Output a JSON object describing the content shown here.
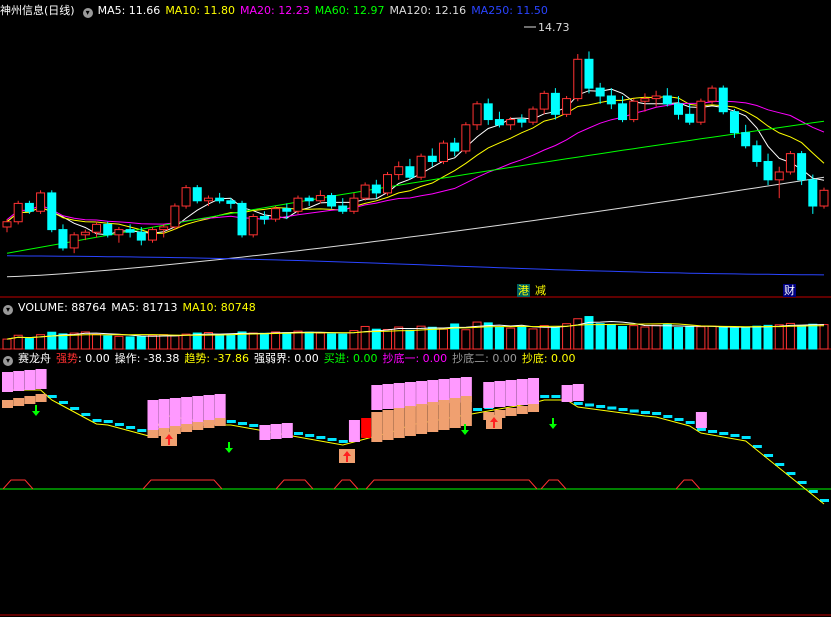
{
  "main_header": {
    "stock_name": "神州信息(日线)",
    "ma_items": [
      {
        "label": "MA5: 11.66",
        "color": "#ffffff"
      },
      {
        "label": "MA10: 11.80",
        "color": "#ffff00"
      },
      {
        "label": "MA20: 12.23",
        "color": "#ff00ff"
      },
      {
        "label": "MA60: 12.97",
        "color": "#00ff00"
      },
      {
        "label": "MA120: 12.16",
        "color": "#dcdcdc"
      },
      {
        "label": "MA250: 11.50",
        "color": "#2a44ff"
      }
    ]
  },
  "volume_header": {
    "items": [
      {
        "label": "VOLUME: 88764",
        "color": "#ffffff"
      },
      {
        "label": "MA5: 81713",
        "color": "#ffffff"
      },
      {
        "label": "MA10: 80748",
        "color": "#ffff00"
      }
    ]
  },
  "indicator_header": {
    "name": "赛龙舟",
    "items": [
      {
        "label": "强势",
        "value": ": 0.00",
        "color": "#ff3030"
      },
      {
        "label": "操作",
        "value": ": -38.38",
        "color": "#ffffff"
      },
      {
        "label": "趋势",
        "value": ": -37.86",
        "color": "#ffff00"
      },
      {
        "label": "强弱界",
        "value": ": 0.00",
        "color": "#ffffff"
      },
      {
        "label": "买进",
        "value": ": 0.00",
        "color": "#00ff00"
      },
      {
        "label": "抄底一",
        "value": ": 0.00",
        "color": "#ff00ff"
      },
      {
        "label": "抄底二",
        "value": ": 0.00",
        "color": "#999999"
      },
      {
        "label": "抄底",
        "value": ": 0.00",
        "color": "#ffff00"
      }
    ]
  },
  "markers": {
    "high_price": "14.73",
    "event_1": "港",
    "event_2": "减",
    "event_3": "财"
  },
  "colors": {
    "up": "#ff3232",
    "down": "#00ffff",
    "ma5": "#ffffff",
    "ma10": "#ffff00",
    "ma20": "#ff00ff",
    "ma60": "#00ff00",
    "ma120": "#dcdcdc",
    "ma250": "#2a44ff",
    "pink": "#ff99ff",
    "tan": "#f0a070",
    "cyan": "#00e5ff",
    "green": "#00ff00",
    "divider": "#c00000"
  },
  "chart_data": {
    "type": "candlestick",
    "candles": [
      [
        11.05,
        11.2,
        10.95,
        11.15
      ],
      [
        11.15,
        11.55,
        11.1,
        11.5
      ],
      [
        11.5,
        11.55,
        11.3,
        11.35
      ],
      [
        11.35,
        11.75,
        11.3,
        11.7
      ],
      [
        11.7,
        11.75,
        10.95,
        11.0
      ],
      [
        11.0,
        11.1,
        10.6,
        10.65
      ],
      [
        10.65,
        10.95,
        10.55,
        10.9
      ],
      [
        10.9,
        11.0,
        10.8,
        10.95
      ],
      [
        10.95,
        11.15,
        10.85,
        11.1
      ],
      [
        11.1,
        11.15,
        10.85,
        10.9
      ],
      [
        10.9,
        11.05,
        10.75,
        11.0
      ],
      [
        11.0,
        11.1,
        10.85,
        10.95
      ],
      [
        10.95,
        11.05,
        10.7,
        10.8
      ],
      [
        10.8,
        11.05,
        10.75,
        11.0
      ],
      [
        11.0,
        11.1,
        10.85,
        11.05
      ],
      [
        11.05,
        11.5,
        11.0,
        11.45
      ],
      [
        11.45,
        11.85,
        11.4,
        11.8
      ],
      [
        11.8,
        11.85,
        11.5,
        11.55
      ],
      [
        11.55,
        11.65,
        11.45,
        11.6
      ],
      [
        11.6,
        11.7,
        11.5,
        11.55
      ],
      [
        11.55,
        11.6,
        11.4,
        11.5
      ],
      [
        11.5,
        11.55,
        10.85,
        10.9
      ],
      [
        10.9,
        11.3,
        10.85,
        11.25
      ],
      [
        11.25,
        11.35,
        11.1,
        11.2
      ],
      [
        11.2,
        11.45,
        11.15,
        11.4
      ],
      [
        11.4,
        11.5,
        11.2,
        11.35
      ],
      [
        11.35,
        11.65,
        11.3,
        11.6
      ],
      [
        11.6,
        11.65,
        11.45,
        11.55
      ],
      [
        11.55,
        11.75,
        11.5,
        11.65
      ],
      [
        11.65,
        11.7,
        11.4,
        11.45
      ],
      [
        11.45,
        11.6,
        11.3,
        11.35
      ],
      [
        11.35,
        11.7,
        11.3,
        11.6
      ],
      [
        11.6,
        11.9,
        11.55,
        11.85
      ],
      [
        11.85,
        11.95,
        11.6,
        11.7
      ],
      [
        11.7,
        12.1,
        11.65,
        12.05
      ],
      [
        12.05,
        12.3,
        11.95,
        12.2
      ],
      [
        12.2,
        12.35,
        11.95,
        12.0
      ],
      [
        12.0,
        12.45,
        11.95,
        12.4
      ],
      [
        12.4,
        12.55,
        12.2,
        12.3
      ],
      [
        12.3,
        12.7,
        12.25,
        12.65
      ],
      [
        12.65,
        12.75,
        12.4,
        12.5
      ],
      [
        12.5,
        13.05,
        12.45,
        13.0
      ],
      [
        13.0,
        13.45,
        12.9,
        13.4
      ],
      [
        13.4,
        13.5,
        13.0,
        13.1
      ],
      [
        13.1,
        13.25,
        12.95,
        13.0
      ],
      [
        13.0,
        13.15,
        12.9,
        13.1
      ],
      [
        13.1,
        13.2,
        12.95,
        13.05
      ],
      [
        13.05,
        13.35,
        13.0,
        13.3
      ],
      [
        13.3,
        13.65,
        13.2,
        13.6
      ],
      [
        13.6,
        13.7,
        13.1,
        13.2
      ],
      [
        13.2,
        13.55,
        13.15,
        13.5
      ],
      [
        13.5,
        14.35,
        13.45,
        14.25
      ],
      [
        14.25,
        14.4,
        13.6,
        13.7
      ],
      [
        13.7,
        13.8,
        13.4,
        13.55
      ],
      [
        13.55,
        13.7,
        13.3,
        13.4
      ],
      [
        13.4,
        13.55,
        13.05,
        13.1
      ],
      [
        13.1,
        13.5,
        13.05,
        13.45
      ],
      [
        13.45,
        13.6,
        13.25,
        13.5
      ],
      [
        13.5,
        13.65,
        13.35,
        13.55
      ],
      [
        13.55,
        13.7,
        13.35,
        13.4
      ],
      [
        13.4,
        13.55,
        13.1,
        13.2
      ],
      [
        13.2,
        13.4,
        13.0,
        13.05
      ],
      [
        13.05,
        13.5,
        13.0,
        13.45
      ],
      [
        13.45,
        13.75,
        13.4,
        13.7
      ],
      [
        13.7,
        13.75,
        13.2,
        13.25
      ],
      [
        13.25,
        13.3,
        12.75,
        12.85
      ],
      [
        12.85,
        13.0,
        12.55,
        12.6
      ],
      [
        12.6,
        12.7,
        12.2,
        12.3
      ],
      [
        12.3,
        12.45,
        11.85,
        11.95
      ],
      [
        11.95,
        12.2,
        11.6,
        12.1
      ],
      [
        12.1,
        12.5,
        12.05,
        12.45
      ],
      [
        12.45,
        12.5,
        11.85,
        11.95
      ],
      [
        11.95,
        12.05,
        11.3,
        11.45
      ],
      [
        11.45,
        11.8,
        11.4,
        11.75
      ]
    ],
    "high_label": "14.73",
    "volume": {
      "values": [
        36000,
        50000,
        38000,
        52000,
        61000,
        55000,
        58000,
        62000,
        53000,
        48000,
        46000,
        44000,
        45000,
        50000,
        52000,
        48000,
        54000,
        58000,
        60000,
        51000,
        53000,
        62000,
        58000,
        57000,
        62000,
        59000,
        65000,
        61000,
        58000,
        55000,
        54000,
        67000,
        82000,
        72000,
        71000,
        80000,
        68000,
        83000,
        79000,
        72000,
        91000,
        70000,
        98000,
        95000,
        80000,
        76000,
        82000,
        73000,
        85000,
        78000,
        92000,
        110000,
        118000,
        92000,
        88000,
        82000,
        85000,
        80000,
        86000,
        89000,
        78000,
        80000,
        81000,
        83000,
        79000,
        76000,
        80000,
        83000,
        86000,
        88000,
        93000,
        84000,
        90000,
        88764
      ],
      "ma5": [
        81713
      ],
      "ma10": [
        80748
      ]
    }
  }
}
